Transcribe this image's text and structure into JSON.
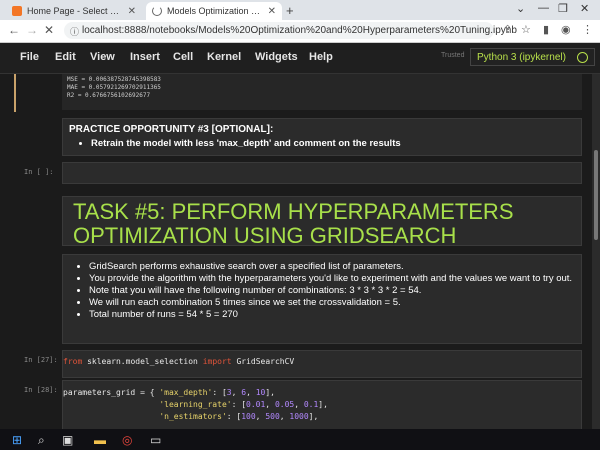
{
  "browser": {
    "tabs": [
      {
        "title": "Home Page - Select or create a n"
      },
      {
        "title": "Models Optimization and Hyperp"
      }
    ],
    "new_tab": "+",
    "url": "localhost:8888/notebooks/Models%20Optimization%20and%20Hyperparameters%20Tuning.ipynb"
  },
  "menubar": {
    "items": [
      "File",
      "Edit",
      "View",
      "Insert",
      "Cell",
      "Kernel",
      "Widgets",
      "Help"
    ],
    "trusted": "Trusted",
    "kernel": "Python 3 (ipykernel)"
  },
  "cells": {
    "metrics": {
      "mse": "MSE = 0.006387528745398583",
      "mae": "MAE = 0.057921269702911365",
      "r2": "R2 = 0.6766756102692677"
    },
    "practice": {
      "title": "PRACTICE OPPORTUNITY #3 [OPTIONAL]:",
      "bullet": "Retrain the model with less 'max_depth' and comment on the results"
    },
    "empty_prompt": "In [ ]:",
    "task": {
      "line1": "TASK #5: PERFORM HYPERPARAMETERS",
      "line2": "OPTIMIZATION USING GRIDSEARCH"
    },
    "bullets": [
      "GridSearch performs exhaustive search over a specified list of parameters.",
      "You provide the algorithm with the hyperparameters you'd like to experiment with and the values we want to try out.",
      "Note that you will have the following number of combinations: 3 * 3 * 3 * 2 = 54.",
      "We will run each combination 5 times since we set the crossvalidation = 5.",
      "Total number of runs = 54 * 5 = 270"
    ],
    "import_cell": {
      "prompt": "In [27]:",
      "kw_from": "from",
      "module": "sklearn.model_selection",
      "kw_import": "import",
      "name": "GridSearchCV"
    },
    "grid_cell": {
      "prompt": "In [28]:",
      "var": "parameters_grid = { ",
      "k1": "'max_depth'",
      "v1a": "3",
      "v1b": "6",
      "v1c": "10",
      "k2": "'learning_rate'",
      "v2a": "0.01",
      "v2b": "0.05",
      "v2c": "0.1",
      "k3": "'n_estimators'",
      "v3a": "100",
      "v3b": "500",
      "v3c": "1000"
    }
  }
}
